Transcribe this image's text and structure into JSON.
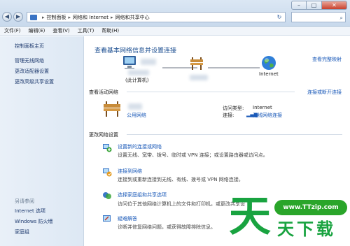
{
  "window": {
    "controls": {
      "minimize": "–",
      "maximize": "□",
      "close": "✕"
    },
    "nav": {
      "back": "◀",
      "forward": "▶"
    },
    "breadcrumb": [
      "控制面板",
      "网络和 Internet",
      "网络和共享中心"
    ],
    "breadcrumb_sep": "▸",
    "search_placeholder": "",
    "refresh": "↻"
  },
  "menu": [
    "文件(F)",
    "编辑(E)",
    "查看(V)",
    "工具(T)",
    "帮助(H)"
  ],
  "sidebar": {
    "links": [
      "控制面板主页",
      "管理无线网络",
      "更改适配器设置",
      "更改高级共享设置"
    ],
    "see_also_heading": "另请参阅",
    "see_also": [
      "Internet 选项",
      "Windows 防火墙",
      "家庭组"
    ]
  },
  "main": {
    "title": "查看基本网络信息并设置连接",
    "full_map_link": "查看完整映射",
    "node_pc_label": "(此计算机)",
    "node_internet_label": "Internet",
    "active_heading": "查看活动网络",
    "connect_link": "连接或断开连接",
    "network_type": "公用网络",
    "access_type_label": "访问类型:",
    "access_type_value": "Internet",
    "connection_label": "连接:",
    "connection_value": "无线网络连接",
    "change_heading": "更改网络设置",
    "tasks": [
      {
        "title": "设置新的连接或网络",
        "desc": "设置无线、宽带、拨号、临时或 VPN 连接；或设置路由器或访问点。",
        "icon": "new-connection-icon"
      },
      {
        "title": "连接到网络",
        "desc": "连接到或重新连接到无线、有线、拨号或 VPN 网络连接。",
        "icon": "connect-network-icon"
      },
      {
        "title": "选择家庭组和共享选项",
        "desc": "访问位于其他网络计算机上的文件和打印机，或更改共享设",
        "icon": "homegroup-icon"
      },
      {
        "title": "疑难解答",
        "desc": "诊断并修复网络问题，或获得故障排除信息。",
        "icon": "troubleshoot-icon"
      }
    ]
  },
  "watermark": {
    "url": "www.TTzip.com",
    "big_char": "天",
    "sub_text": "天下载"
  },
  "colors": {
    "link": "#1a59b8",
    "title": "#1d4f91",
    "watermark": "#19a340"
  }
}
